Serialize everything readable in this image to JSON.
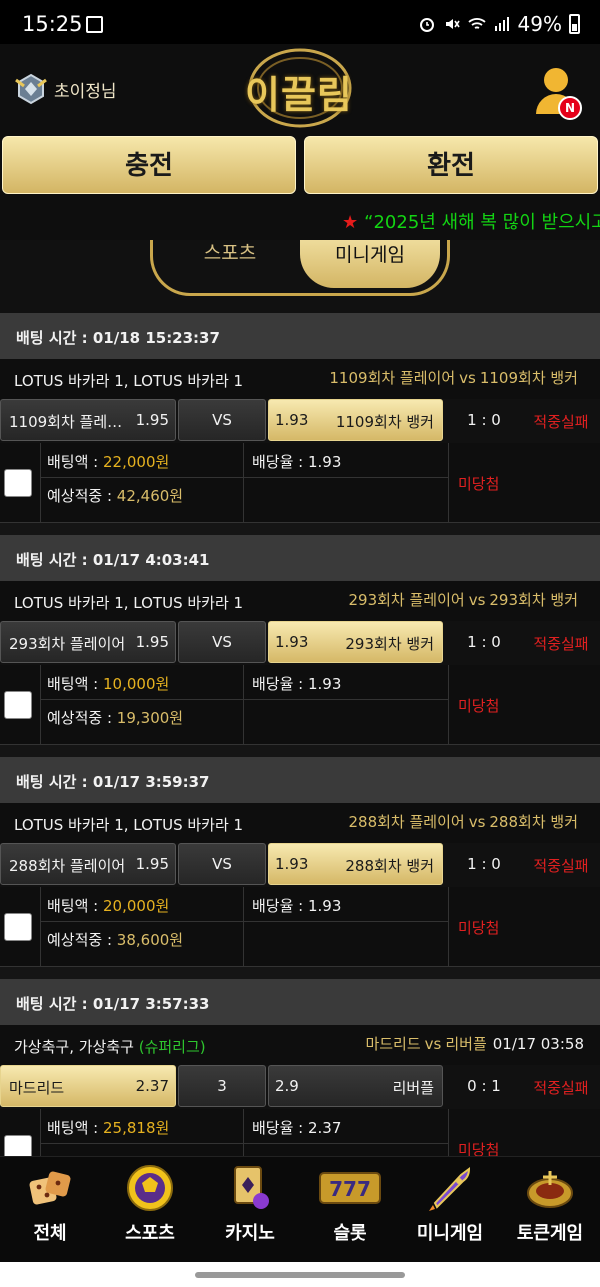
{
  "status_bar": {
    "time": "15:25",
    "battery": "49%"
  },
  "header": {
    "username": "초이정님",
    "logo_text": "이끌림",
    "notification_badge": "N"
  },
  "actions": {
    "charge": "충전",
    "exchange": "환전"
  },
  "ticker": {
    "text": "“2025년 새해 복 많이 받으시고"
  },
  "tabs": {
    "sports": "스포츠",
    "mini": "미니게임"
  },
  "bets": [
    {
      "time": "배팅 시간 : 01/18 15:23:37",
      "league": "LOTUS 바카라 1, LOTUS 바카라 1",
      "league_sub": "",
      "team_home": "1109회차 플레이어",
      "vs": "vs",
      "team_away": "1109회차 뱅커",
      "date": "",
      "home_label": "1109회차 플레…",
      "home_odds": "1.95",
      "mid": "VS",
      "away_odds": "1.93",
      "away_label": "1109회차 뱅커",
      "selected": "away",
      "score": "1 : 0",
      "result": "적중실패",
      "amount_label": "배팅액 : ",
      "amount": "22,000원",
      "rate_label": "배당율 : ",
      "rate": "1.93",
      "expected_label": "예상적중 : ",
      "expected": "42,460원",
      "status": "미당첨"
    },
    {
      "time": "배팅 시간 : 01/17 4:03:41",
      "league": "LOTUS 바카라 1, LOTUS 바카라 1",
      "league_sub": "",
      "team_home": "293회차 플레이어",
      "vs": "vs",
      "team_away": "293회차 뱅커",
      "date": "",
      "home_label": "293회차 플레이어",
      "home_odds": "1.95",
      "mid": "VS",
      "away_odds": "1.93",
      "away_label": "293회차 뱅커",
      "selected": "away",
      "score": "1 : 0",
      "result": "적중실패",
      "amount_label": "배팅액 : ",
      "amount": "10,000원",
      "rate_label": "배당율 : ",
      "rate": "1.93",
      "expected_label": "예상적중 : ",
      "expected": "19,300원",
      "status": "미당첨"
    },
    {
      "time": "배팅 시간 : 01/17 3:59:37",
      "league": "LOTUS 바카라 1, LOTUS 바카라 1",
      "league_sub": "",
      "team_home": "288회차 플레이어",
      "vs": "vs",
      "team_away": "288회차 뱅커",
      "date": "",
      "home_label": "288회차 플레이어",
      "home_odds": "1.95",
      "mid": "VS",
      "away_odds": "1.93",
      "away_label": "288회차 뱅커",
      "selected": "away",
      "score": "1 : 0",
      "result": "적중실패",
      "amount_label": "배팅액 : ",
      "amount": "20,000원",
      "rate_label": "배당율 : ",
      "rate": "1.93",
      "expected_label": "예상적중 : ",
      "expected": "38,600원",
      "status": "미당첨"
    },
    {
      "time": "배팅 시간 : 01/17 3:57:33",
      "league": "가상축구, 가상축구 ",
      "league_sub": "(슈퍼리그)",
      "team_home": "마드리드",
      "vs": "vs",
      "team_away": "리버플",
      "date": "01/17 03:58",
      "home_label": "마드리드",
      "home_odds": "2.37",
      "mid": "3",
      "away_odds": "2.9",
      "away_label": "리버플",
      "selected": "home",
      "score": "0 : 1",
      "result": "적중실패",
      "amount_label": "배팅액 : ",
      "amount": "25,818원",
      "rate_label": "배당율 : ",
      "rate": "2.37",
      "expected_label": "",
      "expected": "",
      "status": "미당첨"
    }
  ],
  "nav": [
    {
      "label": "전체",
      "icon": "dice-icon"
    },
    {
      "label": "스포츠",
      "icon": "soccer-ball-icon"
    },
    {
      "label": "카지노",
      "icon": "cards-icon"
    },
    {
      "label": "슬롯",
      "icon": "slot-777-icon"
    },
    {
      "label": "미니게임",
      "icon": "rocket-icon"
    },
    {
      "label": "토큰게임",
      "icon": "roulette-icon"
    }
  ],
  "colors": {
    "gold": "#d9bd6a",
    "loss_red": "#e02020",
    "ticker_green": "#13d413"
  }
}
